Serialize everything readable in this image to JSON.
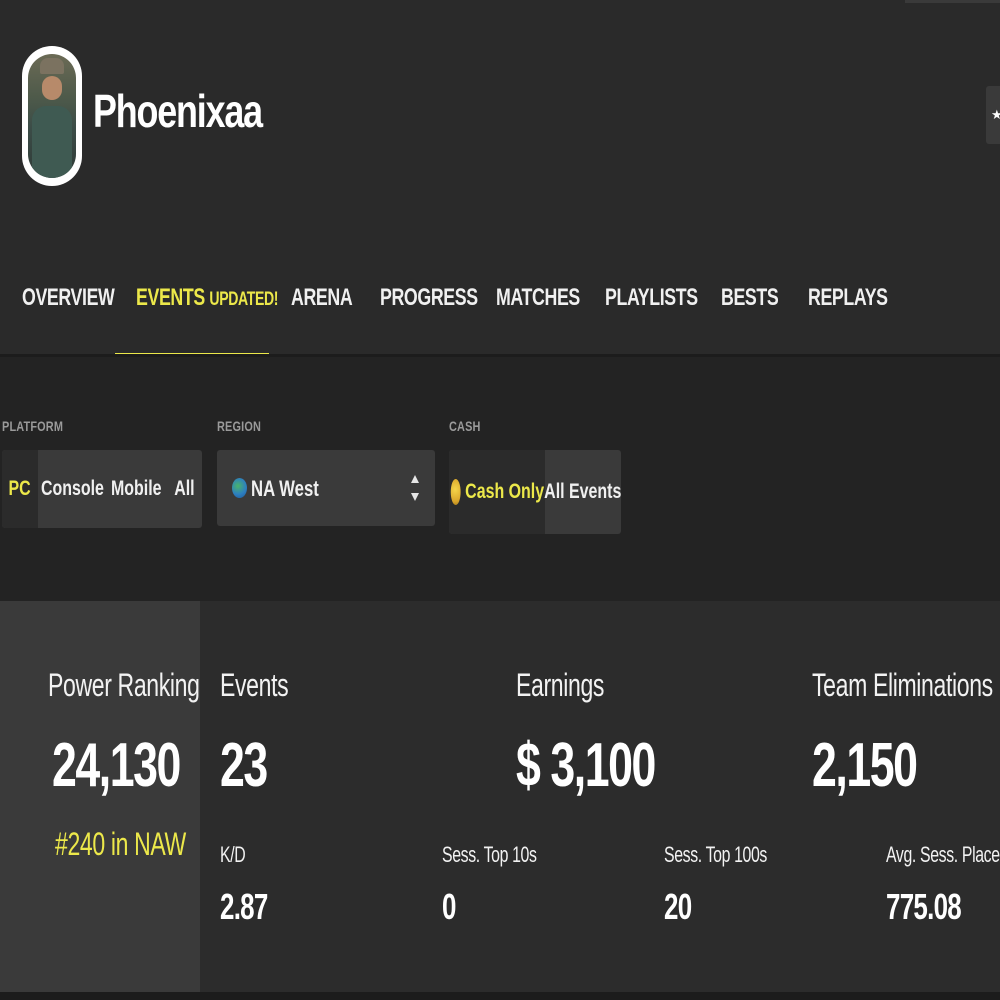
{
  "profile": {
    "name": "Phoenixaa"
  },
  "header": {
    "favorite_glyph": "★"
  },
  "tabs": [
    {
      "label": "OVERVIEW",
      "badge": ""
    },
    {
      "label": "EVENTS",
      "badge": "UPDATED!"
    },
    {
      "label": "ARENA",
      "badge": ""
    },
    {
      "label": "PROGRESS",
      "badge": ""
    },
    {
      "label": "MATCHES",
      "badge": ""
    },
    {
      "label": "PLAYLISTS",
      "badge": ""
    },
    {
      "label": "BESTS",
      "badge": ""
    },
    {
      "label": "REPLAYS",
      "badge": ""
    }
  ],
  "active_tab": "EVENTS",
  "filters": {
    "platform": {
      "label": "PLATFORM",
      "options": [
        "PC",
        "Console",
        "Mobile",
        "All"
      ],
      "selected": "PC"
    },
    "region": {
      "label": "REGION",
      "value": "NA West"
    },
    "cash": {
      "label": "CASH",
      "options": [
        "Cash Only",
        "All Events"
      ],
      "selected": "Cash Only"
    }
  },
  "stats": {
    "power_ranking": {
      "label": "Power Ranking",
      "value": "24,130",
      "sub": "#240 in NAW"
    },
    "events": {
      "label": "Events",
      "value": "23"
    },
    "earnings": {
      "label": "Earnings",
      "value": "$ 3,100"
    },
    "team_eliminations": {
      "label": "Team Eliminations",
      "value": "2,150"
    },
    "kd": {
      "label": "K/D",
      "value": "2.87"
    },
    "sess_top10": {
      "label": "Sess. Top 10s",
      "value": "0"
    },
    "sess_top100": {
      "label": "Sess. Top 100s",
      "value": "20"
    },
    "avg_placement": {
      "label": "Avg. Sess. Placement",
      "value": "775.08"
    }
  },
  "colors": {
    "accent": "#ece84a",
    "background": "#232323",
    "panel": "#2c2c2c",
    "card": "#3a3a3a"
  }
}
